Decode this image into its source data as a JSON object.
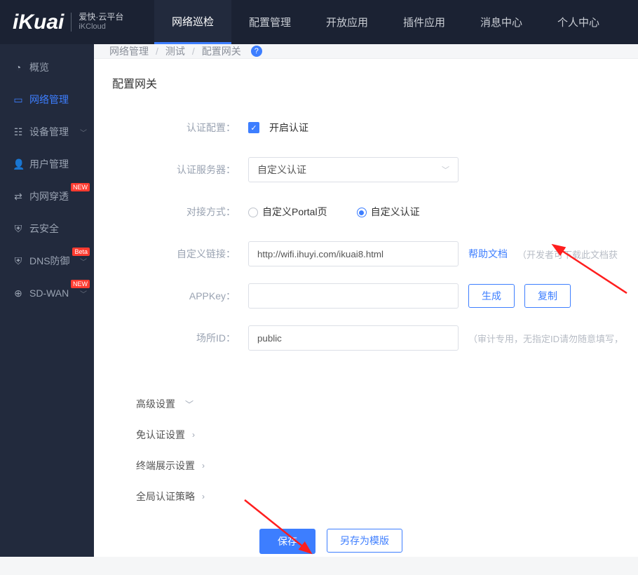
{
  "logo": {
    "brand": "iKuai",
    "cn": "爱快·云平台",
    "en": "iKCloud"
  },
  "topnav": {
    "items": [
      {
        "label": "网络巡检",
        "active": true
      },
      {
        "label": "配置管理"
      },
      {
        "label": "开放应用"
      },
      {
        "label": "插件应用"
      },
      {
        "label": "消息中心"
      },
      {
        "label": "个人中心"
      }
    ]
  },
  "sidebar": {
    "items": [
      {
        "icon": "◔",
        "label": "概览"
      },
      {
        "icon": "▭",
        "label": "网络管理",
        "active": true
      },
      {
        "icon": "☷",
        "label": "设备管理",
        "caret": true
      },
      {
        "icon": "👤",
        "label": "用户管理"
      },
      {
        "icon": "⇄",
        "label": "内网穿透",
        "badge": "NEW"
      },
      {
        "icon": "⛨",
        "label": "云安全"
      },
      {
        "icon": "⛨",
        "label": "DNS防御",
        "caret": true,
        "badge": "Beta"
      },
      {
        "icon": "⊕",
        "label": "SD-WAN",
        "caret": true,
        "badge": "NEW"
      }
    ]
  },
  "breadcrumb": {
    "items": [
      "网络管理",
      "测试",
      "配置网关"
    ]
  },
  "page": {
    "title": "配置网关"
  },
  "form": {
    "auth_config_label": "认证配置：",
    "enable_auth_label": "开启认证",
    "auth_server_label": "认证服务器：",
    "auth_server_value": "自定义认证",
    "docking_label": "对接方式：",
    "dock_opt1": "自定义Portal页",
    "dock_opt2": "自定义认证",
    "custom_link_label": "自定义链接：",
    "custom_link_value": "http://wifi.ihuyi.com/ikuai8.html",
    "help_doc": "帮助文档",
    "help_doc_hint": "（开发者可下载此文档获",
    "appkey_label": "APPKey：",
    "appkey_value": "",
    "btn_generate": "生成",
    "btn_copy": "复制",
    "venue_label": "场所ID：",
    "venue_value": "public",
    "venue_hint": "（审计专用，无指定ID请勿随意填写，"
  },
  "sections": {
    "advanced": "高级设置",
    "noauth": "免认证设置",
    "terminal": "终端展示设置",
    "global": "全局认证策略"
  },
  "footer": {
    "save": "保存",
    "save_as_tpl": "另存为模版"
  }
}
